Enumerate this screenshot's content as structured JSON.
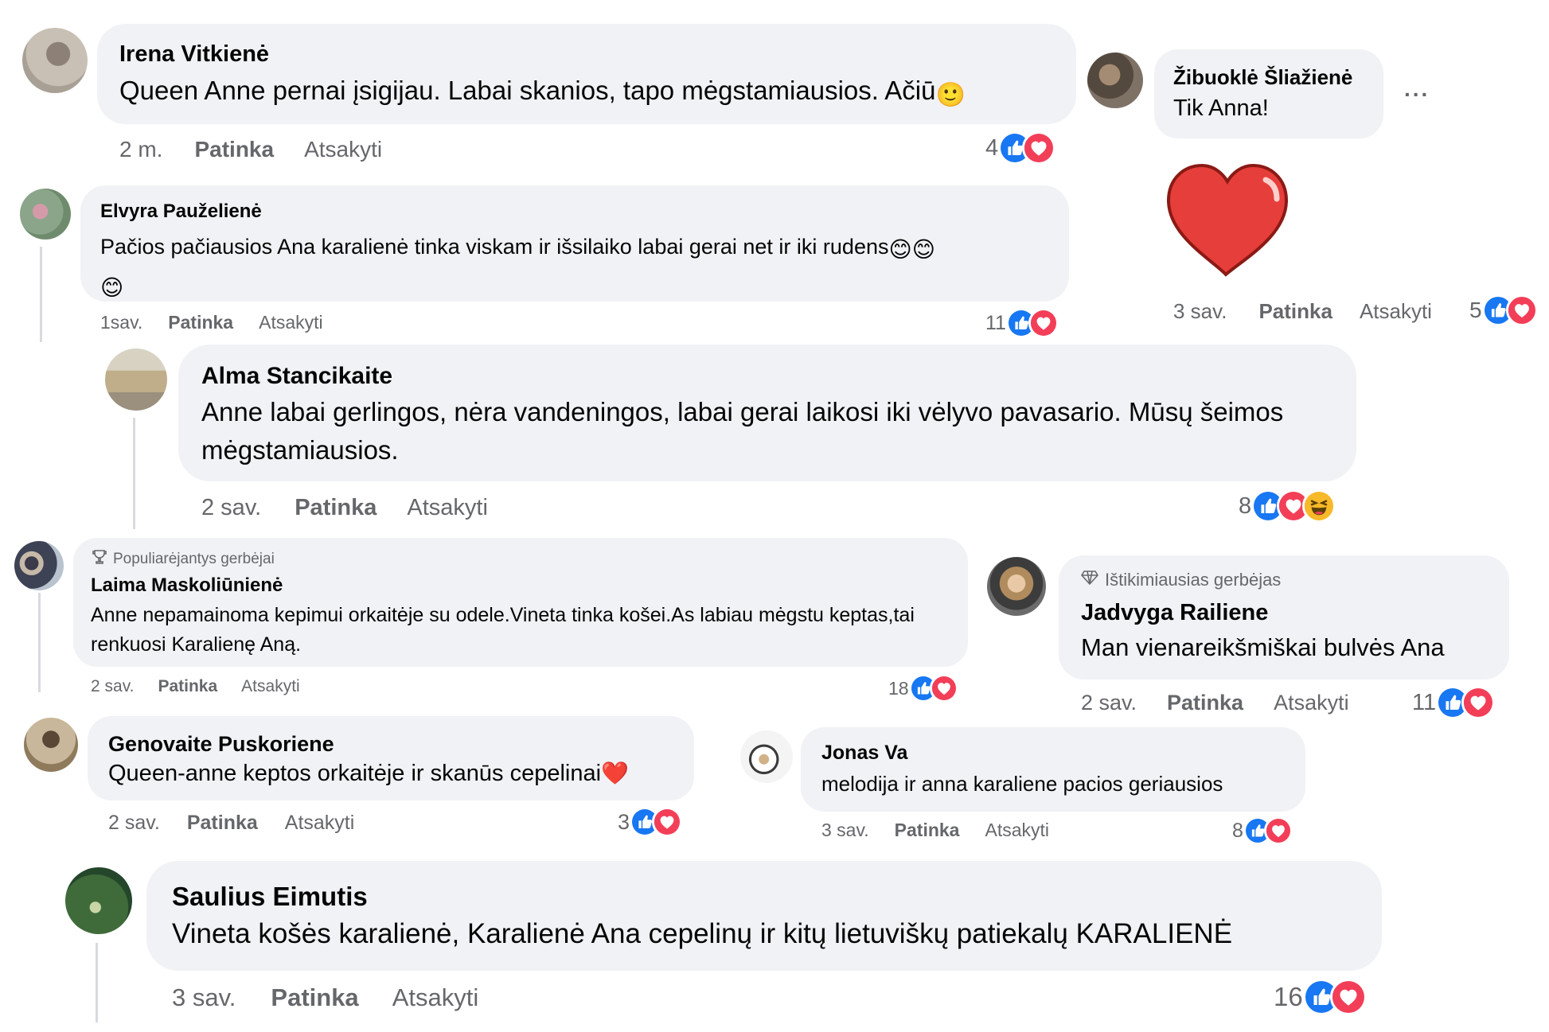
{
  "comments": {
    "c1": {
      "name": "Irena Vitkienė",
      "text": "Queen Anne pernai įsigijau. Labai skanios, tapo mėgstamiausios. Ačiū",
      "emoji": "🙂",
      "time": "2 m.",
      "like": "Patinka",
      "reply": "Atsakyti",
      "reactions": "4"
    },
    "c2": {
      "name": "Elvyra Pauželienė",
      "text": "Pačios pačiausios Ana karalienė tinka viskam ir išsilaiko labai gerai net ir iki rudens",
      "emoji": "😊",
      "time": "1sav.",
      "like": "Patinka",
      "reply": "Atsakyti",
      "reactions": "11"
    },
    "c3": {
      "name": "Alma Stancikaite",
      "text": "Anne labai gerlingos, nėra vandeningos, labai gerai laikosi iki vėlyvo pavasario. Mūsų šeimos mėgstamiausios.",
      "time": "2 sav.",
      "like": "Patinka",
      "reply": "Atsakyti",
      "reactions": "8"
    },
    "c4": {
      "badge": "Populiarėjantys gerbėjai",
      "name": "Laima Maskoliūnienė",
      "text": "Anne nepamainoma kepimui orkaitėje su odele.Vineta tinka košei.As labiau mėgstu keptas,tai renkuosi Karalienę Aną.",
      "time": "2 sav.",
      "like": "Patinka",
      "reply": "Atsakyti",
      "reactions": "18"
    },
    "c5": {
      "name": "Genovaite Puskoriene",
      "text": "Queen-anne keptos orkaitėje ir skanūs cepelinai",
      "emoji": "❤️",
      "time": "2 sav.",
      "like": "Patinka",
      "reply": "Atsakyti",
      "reactions": "3"
    },
    "c6": {
      "name": "Saulius Eimutis",
      "text": "Vineta košės karalienė, Karalienė Ana cepelinų ir kitų lietuviškų patiekalų KARALIENĖ",
      "time": "3 sav.",
      "like": "Patinka",
      "reply": "Atsakyti",
      "reactions": "16"
    },
    "c7": {
      "name": "Žibuoklė Šliažienė",
      "text": "Tik Anna!",
      "more": "...",
      "sticker": "heart",
      "time": "3 sav.",
      "like": "Patinka",
      "reply": "Atsakyti",
      "reactions": "5"
    },
    "c8": {
      "badge": "Ištikimiausias gerbėjas",
      "name": "Jadvyga Railiene",
      "text": "Man vienareikšmiškai bulvės Ana",
      "time": "2 sav.",
      "like": "Patinka",
      "reply": "Atsakyti",
      "reactions": "11"
    },
    "c9": {
      "name": "Jonas Va",
      "text": "melodija ir anna karaliene pacios geriausios",
      "time": "3 sav.",
      "like": "Patinka",
      "reply": "Atsakyti",
      "reactions": "8"
    }
  },
  "colors": {
    "like_blue": "#1877f2",
    "love_red": "#f33e58",
    "haha_yellow": "#f7b928",
    "bubble": "#f0f2f5",
    "meta_gray": "#65676b"
  }
}
